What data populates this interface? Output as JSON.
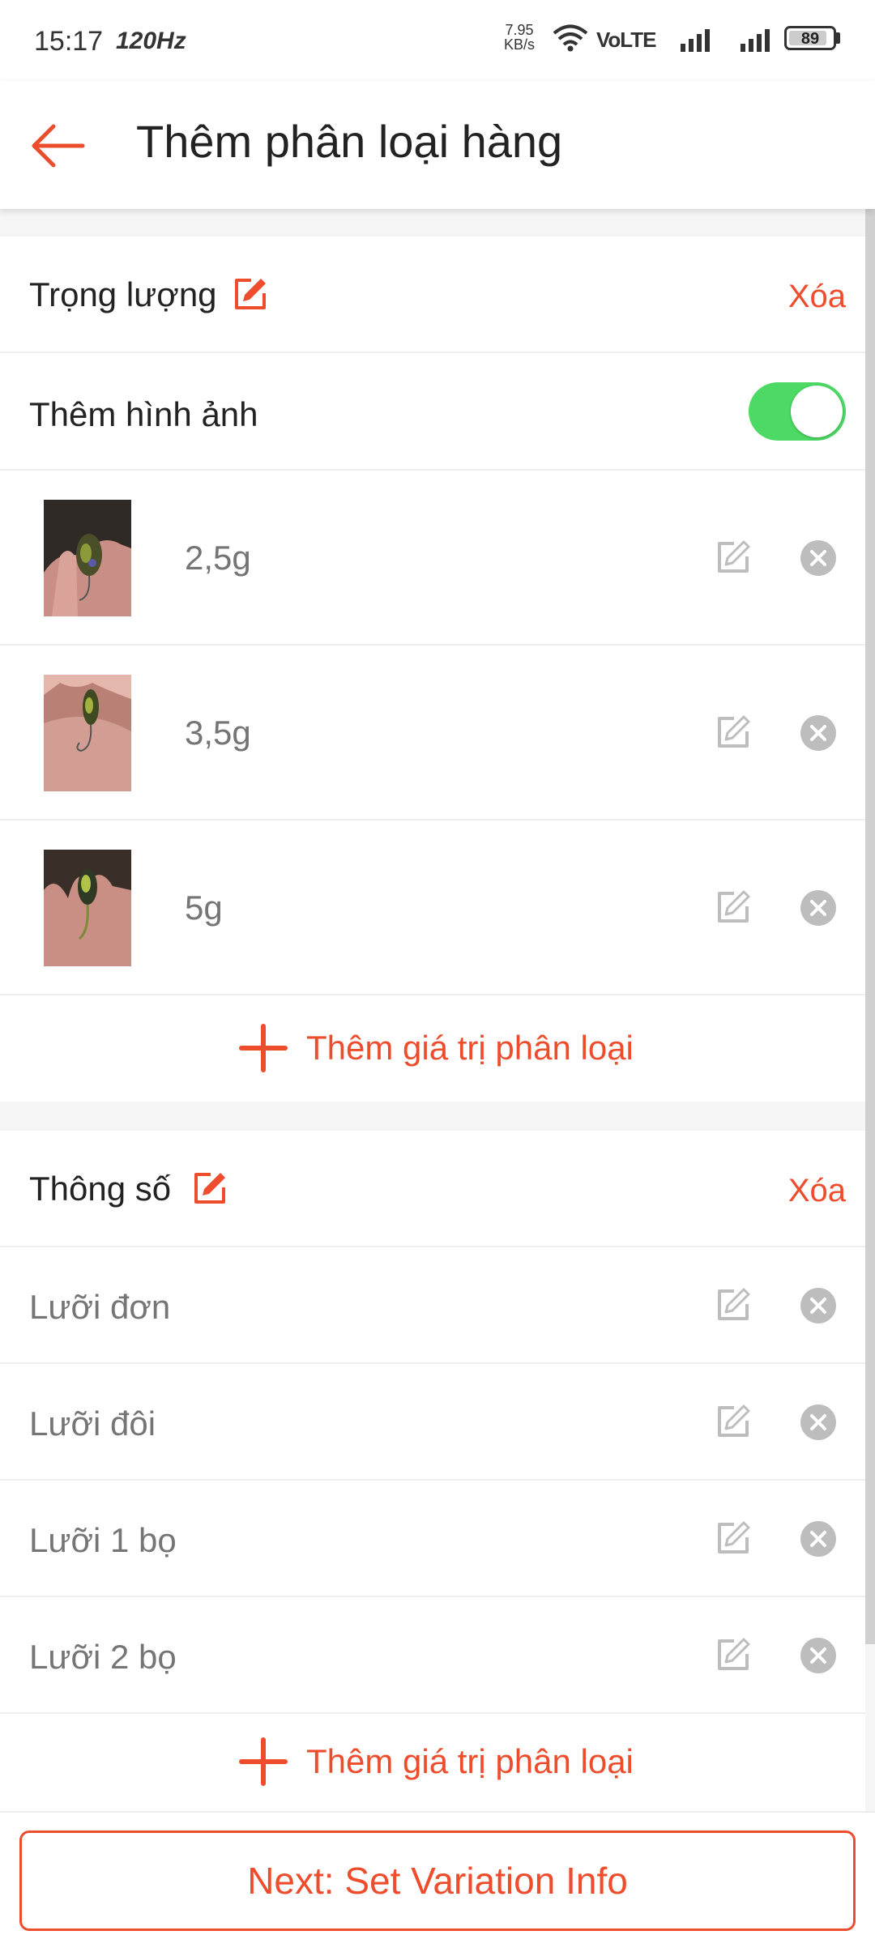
{
  "status_bar": {
    "time": "15:17",
    "refresh_rate": "120Hz",
    "net_speed_value": "7.95",
    "net_speed_unit": "KB/s",
    "network_label": "VoLTE",
    "battery": "89",
    "icons": [
      "wifi-icon",
      "signal-icon",
      "signal-icon",
      "battery-icon"
    ]
  },
  "appbar": {
    "back_icon": "arrow-left-icon",
    "title": "Thêm phân loại hàng"
  },
  "variation1": {
    "title": "Trọng lượng",
    "delete_label": "Xóa",
    "add_image_label": "Thêm hình ảnh",
    "add_image_enabled": true,
    "options": [
      {
        "value": "2,5g",
        "image": "lure-photo-1"
      },
      {
        "value": "3,5g",
        "image": "lure-photo-2"
      },
      {
        "value": "5g",
        "image": "lure-photo-3"
      }
    ],
    "add_option_label": "Thêm giá trị phân loại"
  },
  "variation2": {
    "title": "Thông số",
    "delete_label": "Xóa",
    "options": [
      {
        "value": "Lưỡi đơn"
      },
      {
        "value": "Lưỡi đôi"
      },
      {
        "value": "Lưỡi 1 bọ"
      },
      {
        "value": "Lưỡi 2 bọ"
      }
    ],
    "add_option_label": "Thêm giá trị phân loại"
  },
  "footer": {
    "next_label": "Next: Set Variation Info"
  },
  "colors": {
    "accent": "#ee4d2d",
    "toggle_on": "#4cd964",
    "muted_icon": "#bdbdbd"
  }
}
